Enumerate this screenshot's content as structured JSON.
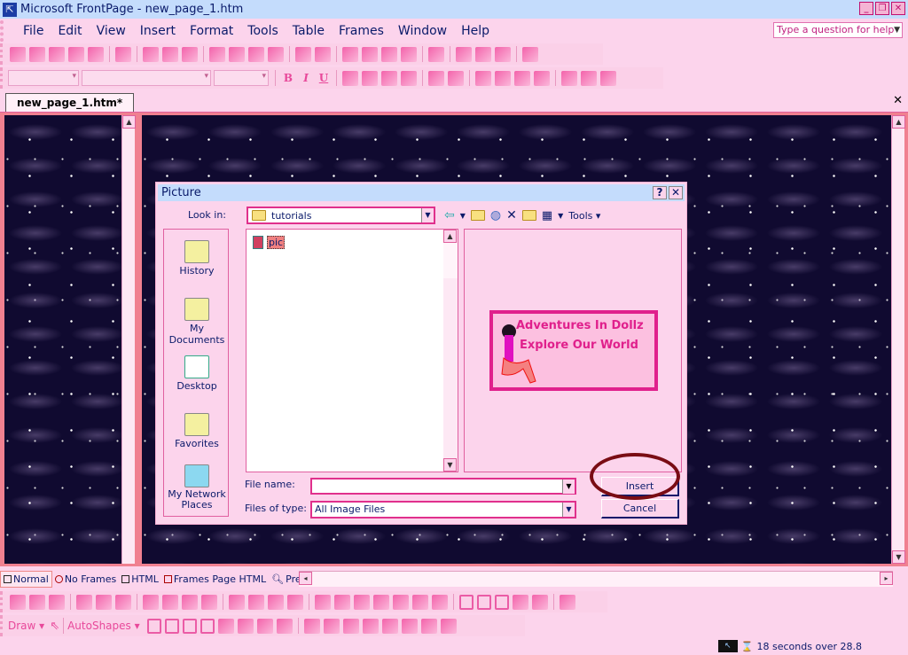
{
  "window": {
    "title": "Microsoft FrontPage - new_page_1.htm",
    "controls": [
      "_",
      "❐",
      "✕"
    ]
  },
  "menu": [
    "File",
    "Edit",
    "View",
    "Insert",
    "Format",
    "Tools",
    "Table",
    "Frames",
    "Window",
    "Help"
  ],
  "help_box": {
    "placeholder": "Type a question for help"
  },
  "standard_toolbar": [
    "new-page-icon",
    "open-icon",
    "save-icon",
    "search-icon",
    "publish-icon",
    "|",
    "folder-list-icon",
    "|",
    "print-icon",
    "print-preview-icon",
    "spelling-icon",
    "|",
    "cut-icon",
    "copy-icon",
    "paste-icon",
    "format-painter-icon",
    "|",
    "undo-icon",
    "redo-icon",
    "|",
    "web-component-icon",
    "insert-table-icon",
    "insert-picture-icon",
    "drawing-icon",
    "|",
    "hyperlink-icon",
    "|",
    "refresh-icon",
    "stop-icon",
    "show-all-icon",
    "|",
    "help-icon"
  ],
  "formatting_toolbar": {
    "bold": "B",
    "italic": "I",
    "underline": "U",
    "items": [
      "align-left-icon",
      "center-icon",
      "align-right-icon",
      "justify-icon",
      "|",
      "increase-font-icon",
      "decrease-font-icon",
      "|",
      "numbering-icon",
      "bullets-icon",
      "decrease-indent-icon",
      "increase-indent-icon",
      "|",
      "borders-icon",
      "highlight-icon",
      "font-color-icon"
    ]
  },
  "document_tab": {
    "label": "new_page_1.htm*",
    "close": "✕"
  },
  "dialog": {
    "title": "Picture",
    "help": "?",
    "close": "✕",
    "look_in_label": "Look in:",
    "look_in_value": "tutorials",
    "tools_label": "Tools ▾",
    "places": [
      "History",
      "My Documents",
      "Desktop",
      "Favorites",
      "My Network Places"
    ],
    "files": [
      {
        "name": "pic"
      }
    ],
    "preview_text": [
      "Adventures In Dollz",
      "Explore Our World"
    ],
    "file_name_label": "File name:",
    "file_name_value": "",
    "files_of_type_label": "Files of type:",
    "files_of_type_value": "All Image Files",
    "insert_label": "Insert",
    "cancel_label": "Cancel"
  },
  "view_tabs": [
    "Normal",
    "No Frames",
    "HTML",
    "Frames Page HTML",
    "Preview"
  ],
  "pictures_toolbar": [
    "insert-picture-icon",
    "text-icon",
    "auto-thumbnail-icon",
    "|",
    "position-absolutely-icon",
    "bring-forward-icon",
    "send-backward-icon",
    "|",
    "rotate-left-icon",
    "rotate-right-icon",
    "flip-horizontal-icon",
    "flip-vertical-icon",
    "|",
    "more-contrast-icon",
    "less-contrast-icon",
    "more-brightness-icon",
    "less-brightness-icon",
    "|",
    "crop-icon",
    "line-style-icon",
    "format-picture-icon",
    "set-transparent-color-icon",
    "color-icon",
    "bevel-icon",
    "resample-icon",
    "|",
    "select-icon",
    "rectangle-hotspot-icon",
    "circle-hotspot-icon",
    "polygon-hotspot-icon",
    "highlight-hotspots-icon",
    "|",
    "restore-icon"
  ],
  "drawing_toolbar": {
    "draw_label": "Draw ▾",
    "autoshapes_label": "AutoShapes ▾",
    "items": [
      "line-icon",
      "arrow-icon",
      "rectangle-icon",
      "oval-icon",
      "text-box-icon",
      "wordart-icon",
      "clip-art-icon",
      "picture-icon",
      "|",
      "fill-color-icon",
      "line-color-icon",
      "font-color-icon",
      "line-style-icon",
      "dash-style-icon",
      "arrow-style-icon",
      "shadow-icon",
      "3d-icon"
    ]
  },
  "status": {
    "download_time": "18 seconds over 28.8"
  }
}
